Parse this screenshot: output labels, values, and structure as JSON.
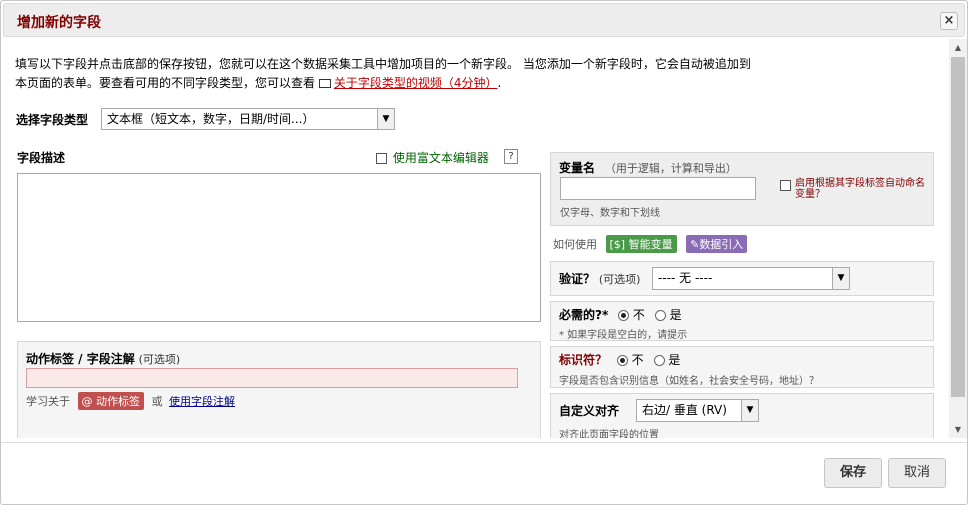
{
  "dialog": {
    "title": "增加新的字段",
    "close_label": "×"
  },
  "intro": {
    "line1": "填写以下字段并点击底部的保存按钮，您就可以在这个数据采集工具中增加项目的一个新字段。 当您添加一个新字段时，它会自动被追加到",
    "line2_prefix": "本页面的表单。要查看可用的不同字段类型，您可以查看 ",
    "video_link": "关于字段类型的视频（4分钟）",
    "line2_suffix": "."
  },
  "field_type": {
    "label": "选择字段类型",
    "value": "文本框（短文本，数字，日期/时间...）"
  },
  "description": {
    "label": "字段描述",
    "rich_text_label": "使用富文本编辑器",
    "help": "?"
  },
  "action_tags": {
    "label": "动作标签 / 字段注解",
    "optional": "(可选项)",
    "learn_prefix": "学习关于",
    "tag_badge": "@ 动作标签",
    "or": "或",
    "annotation_link": "使用字段注解"
  },
  "variable": {
    "label": "变量名",
    "hint": "（用于逻辑，计算和导出）",
    "note": "仅字母、数字和下划线",
    "auto_name_label": "启用根据其字段标签自动命名变量？"
  },
  "how_to_use": {
    "label": "如何使用",
    "smart_vars": "智能变量",
    "piping": "数据引入"
  },
  "validation": {
    "label": "验证？",
    "optional": "(可选项)",
    "value": "---- 无 ----"
  },
  "required": {
    "label": "必需的?*",
    "opt_no": "不",
    "opt_yes": "是",
    "note": "* 如果字段是空白的，请提示"
  },
  "identifier": {
    "label": "标识符？",
    "opt_no": "不",
    "opt_yes": "是",
    "note": "字段是否包含识别信息（如姓名，社会安全号码，地址）？"
  },
  "alignment": {
    "label": "自定义对齐",
    "value": "右边/ 垂直 (RV)",
    "note": "对齐此页面字段的位置"
  },
  "footer": {
    "save": "保存",
    "cancel": "取消"
  },
  "colors": {
    "title": "#800000",
    "link": "#c00000",
    "smart_vars": "#4a9a4a",
    "piping": "#8a6bb5",
    "action_tag_badge": "#c0504d"
  }
}
